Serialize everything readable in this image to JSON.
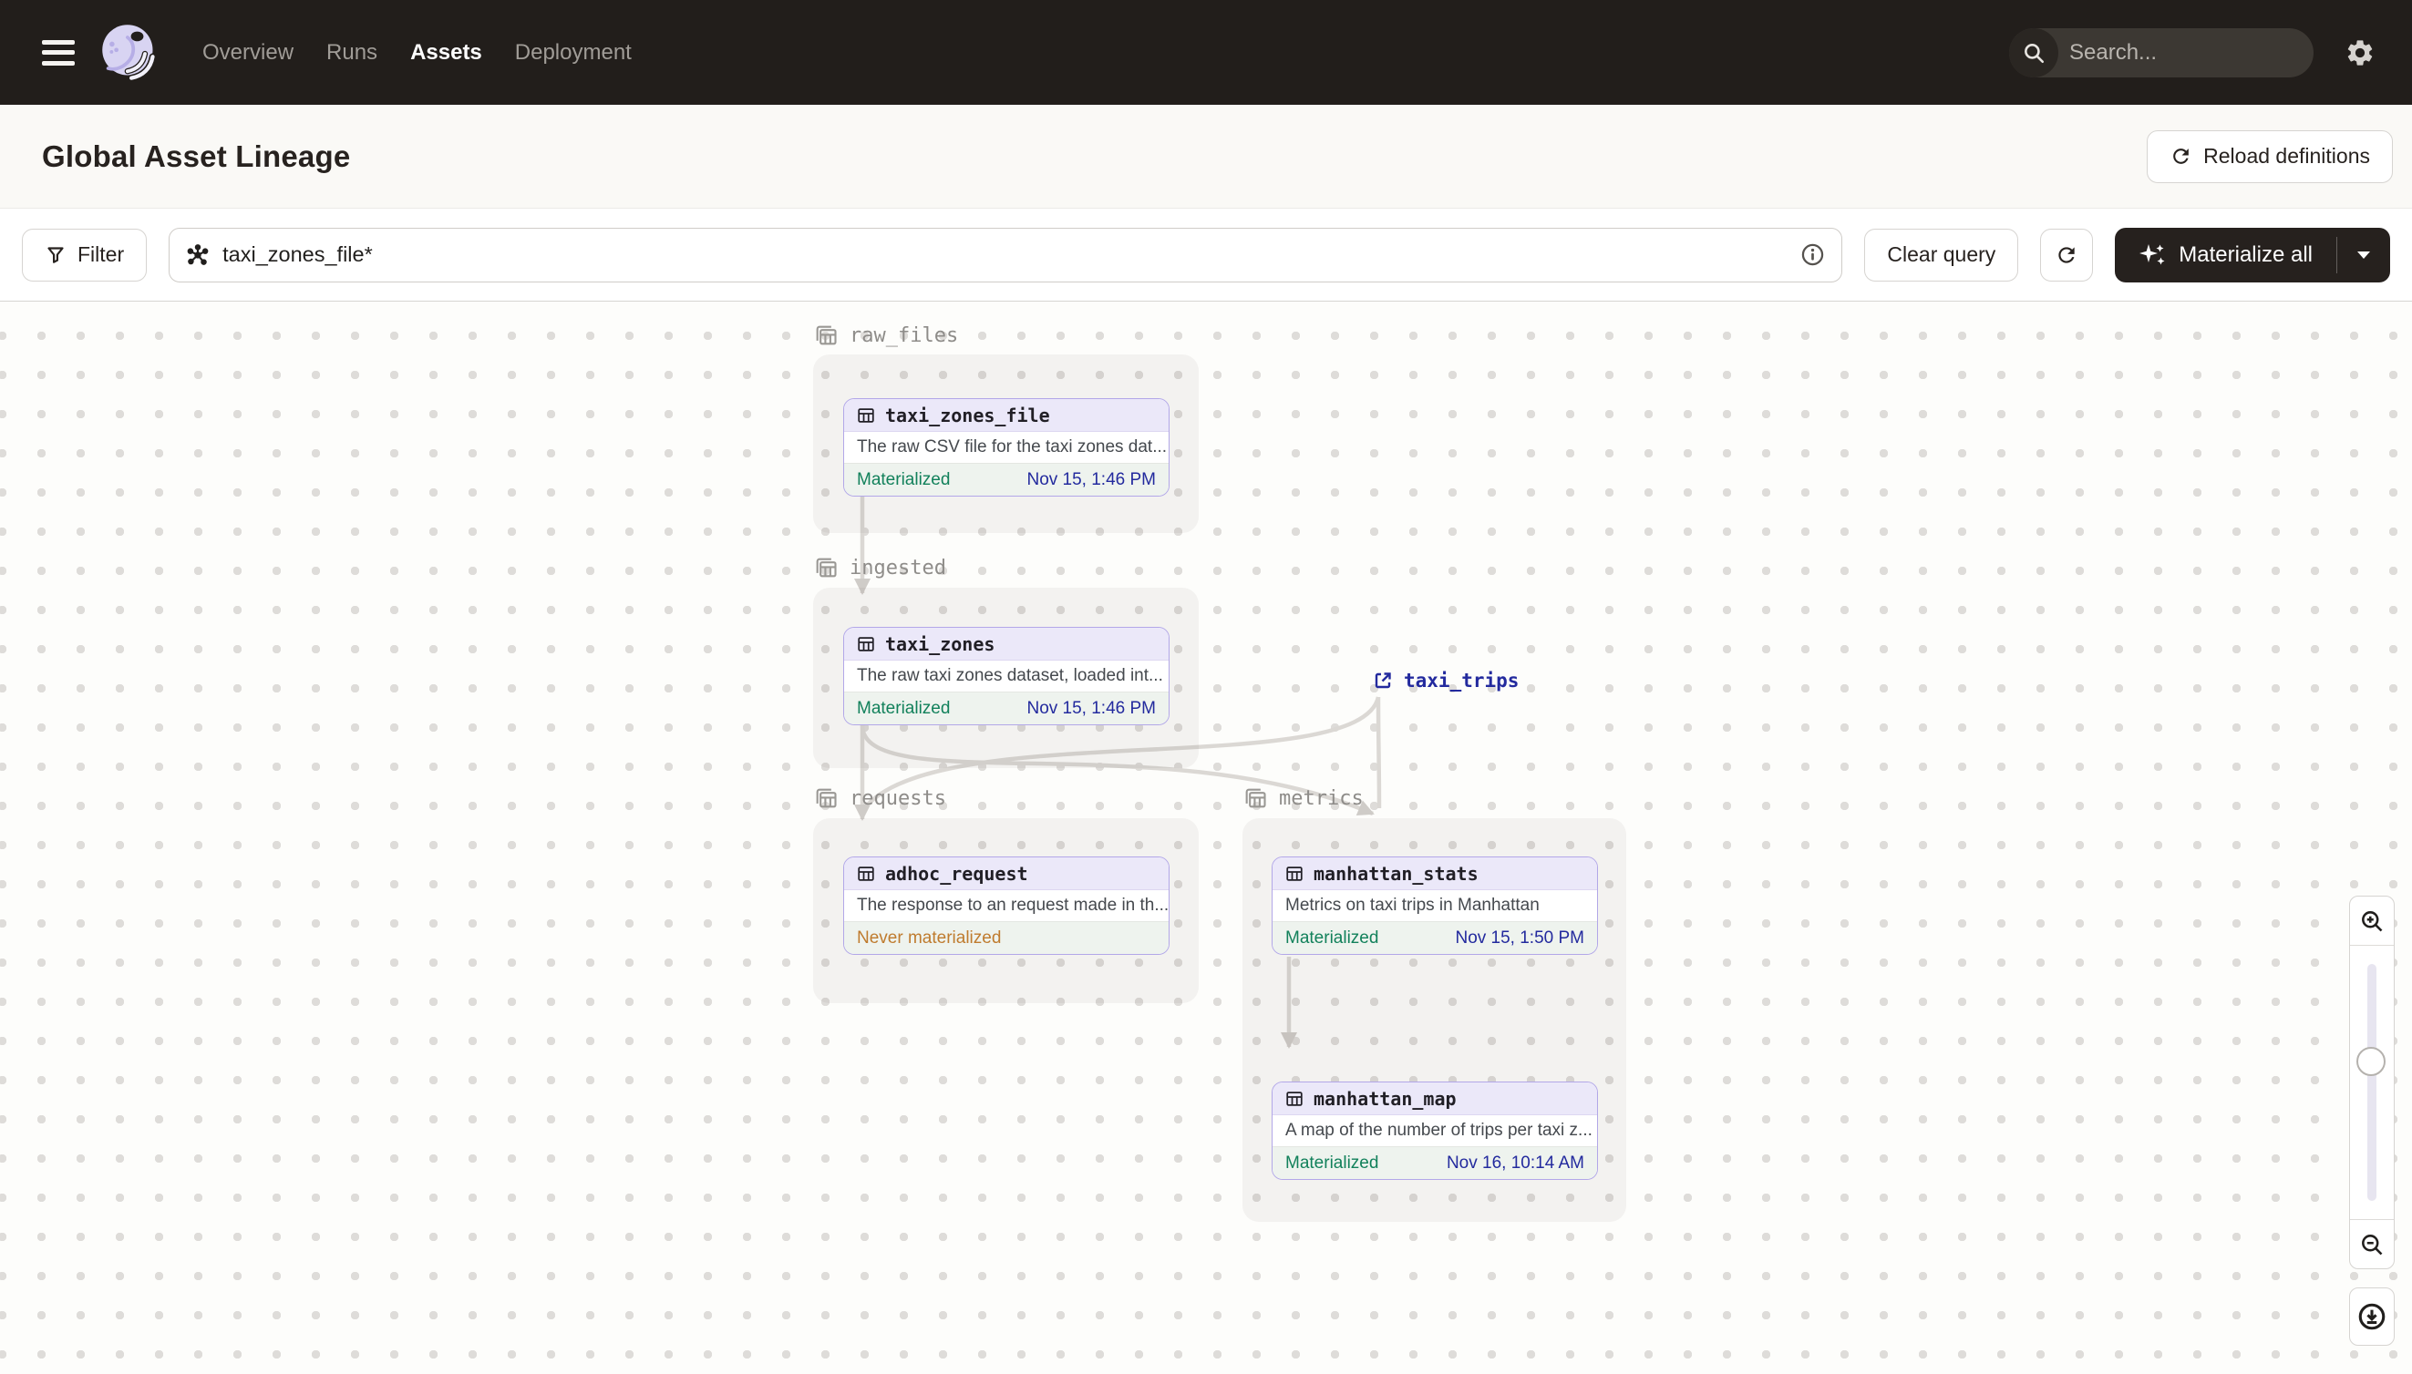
{
  "nav": {
    "items": [
      {
        "label": "Overview",
        "active": false
      },
      {
        "label": "Runs",
        "active": false
      },
      {
        "label": "Assets",
        "active": true
      },
      {
        "label": "Deployment",
        "active": false
      }
    ],
    "search_placeholder": "Search...",
    "search_shortcut": "/"
  },
  "header": {
    "title": "Global Asset Lineage",
    "reload_button_label": "Reload definitions"
  },
  "toolbar": {
    "filter_label": "Filter",
    "query_value": "taxi_zones_file*",
    "clear_query_label": "Clear query",
    "materialize_label": "Materialize all"
  },
  "graph": {
    "groups": [
      {
        "label": "raw_files"
      },
      {
        "label": "ingested"
      },
      {
        "label": "requests"
      },
      {
        "label": "metrics"
      }
    ],
    "nodes": [
      {
        "name": "taxi_zones_file",
        "description": "The raw CSV file for the taxi zones dat...",
        "status": "Materialized",
        "timestamp": "Nov 15, 1:46 PM"
      },
      {
        "name": "taxi_zones",
        "description": "The raw taxi zones dataset, loaded int...",
        "status": "Materialized",
        "timestamp": "Nov 15, 1:46 PM"
      },
      {
        "name": "adhoc_request",
        "description": "The response to an request made in th...",
        "status": "Never materialized",
        "timestamp": ""
      },
      {
        "name": "manhattan_stats",
        "description": "Metrics on taxi trips in Manhattan",
        "status": "Materialized",
        "timestamp": "Nov 15, 1:50 PM"
      },
      {
        "name": "manhattan_map",
        "description": "A map of the number of trips per taxi z...",
        "status": "Materialized",
        "timestamp": "Nov 16, 10:14 AM"
      }
    ],
    "external_asset": {
      "label": "taxi_trips"
    }
  },
  "colors": {
    "node_border": "#b2a7e8",
    "node_header_bg": "#ebe8f9",
    "materialized_green": "#12815b",
    "never_materialized_orange": "#bf7b2e",
    "timestamp_navy": "#232a9e",
    "edge_gray": "#dbd8d4",
    "nav_bg": "#221e1b"
  }
}
